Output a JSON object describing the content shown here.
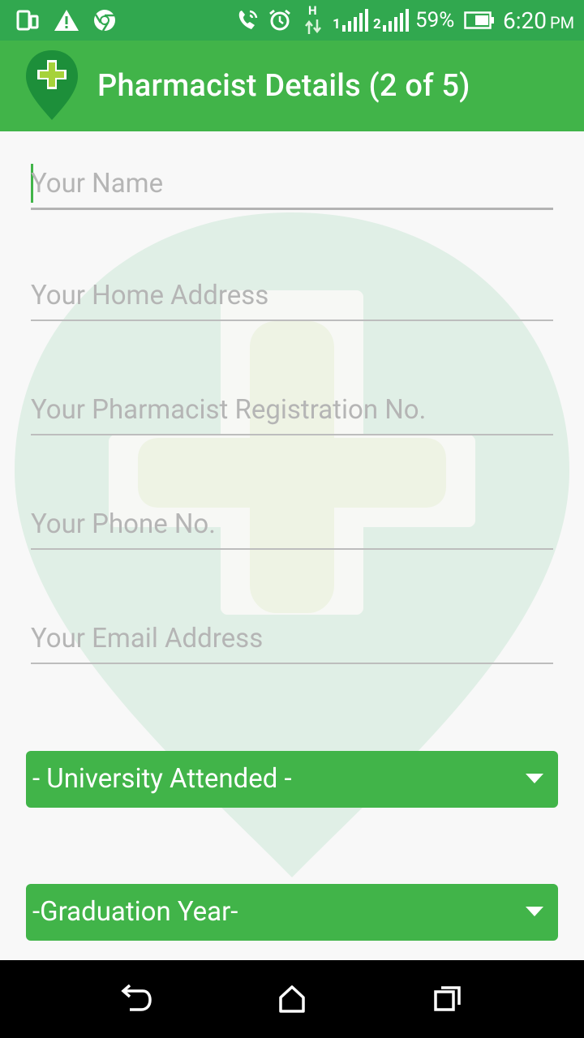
{
  "status_bar": {
    "battery_percent": "59%",
    "time": "6:20",
    "ampm": "PM",
    "network_type": "H",
    "sim1_label": "1",
    "sim2_label": "2",
    "icons": [
      "screen-icon",
      "warning-icon",
      "chrome-icon",
      "wifi-calling-icon",
      "alarm-icon",
      "data-arrows-icon",
      "signal-icon",
      "signal-icon",
      "battery-icon"
    ]
  },
  "app_bar": {
    "title": "Pharmacist Details (2 of 5)",
    "logo_icon": "pharmacy-pin-icon"
  },
  "form": {
    "name_placeholder": "Your Name",
    "address_placeholder": "Your Home Address",
    "registration_placeholder": "Your Pharmacist Registration  No.",
    "phone_placeholder": "Your Phone No.",
    "email_placeholder": "Your Email Address",
    "university_label": "- University Attended -",
    "graduation_label": "-Graduation Year-"
  },
  "nav_bar": {
    "icons": [
      "back-icon",
      "home-icon",
      "recents-icon"
    ]
  },
  "colors": {
    "status_bar": "#31a84f",
    "app_bar": "#41b449",
    "accent": "#41b449",
    "background": "#f8f8f8"
  }
}
